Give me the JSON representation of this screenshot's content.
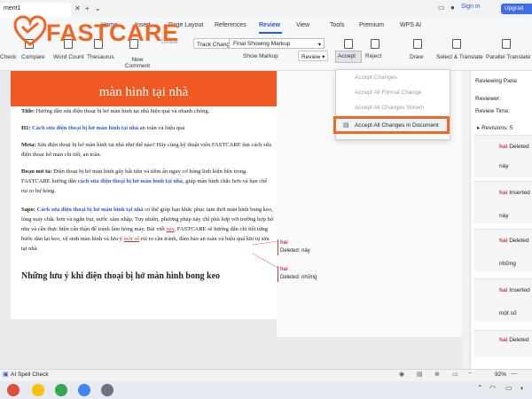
{
  "window": {
    "doc_tab": "ment1",
    "signin": "Sign in",
    "upgrade": "Upgrad"
  },
  "logo": {
    "text": "FASTCARE"
  },
  "menu": [
    "Home",
    "Insert",
    "Page Layout",
    "References",
    "Review",
    "View",
    "Tools",
    "Premium",
    "WPS AI"
  ],
  "ribbon": {
    "check": "Check",
    "compare": "Compare",
    "word_count": "Word Count",
    "thesaurus": "Thesaurus",
    "new_comment": "New Comment",
    "delete": "Delete",
    "track_changes": "Track Changes",
    "markup_value": "Final Showing Markup",
    "show_markup": "Show Markup",
    "review": "Review",
    "accept": "Accept",
    "reject": "Reject",
    "draw": "Draw",
    "select_translate": "Select & Translate",
    "parallel_translate": "Parallel Translate"
  },
  "accept_menu": [
    "Accept Changes",
    "Accept All Format Change",
    "Accept All Changes Shown",
    "Accept All Changes in Document"
  ],
  "document": {
    "banner": "màn hình tại nhà",
    "title_label": "Title:",
    "title_text": "Hướng dẫn sửa điện thoại bị hở màn hình tại nhà hiệu quả và nhanh chóng.",
    "h1_label": "H1:",
    "h1_link": "Cách sửa điện thoại bị hở màn hình tại nhà",
    "h1_rest": " an toàn và hiệu quả",
    "meta_label": "Meta:",
    "meta_text": "Sửa điện thoại bị hở màn hình tại nhà như thế nào? Hãy cùng kỹ thuật viên FASTCARE tìm cách sửa điện thoại hở màn chi tiết, an toàn.",
    "intro_label": "Đoạn mở tả:",
    "intro_text": "Điện thoại bị hở màn hình gây bất tiện và tiềm ẩn nguy cơ hỏng linh kiện bên trong. FASTCARE hướng dẫn",
    "intro_link": "cách sửa điện thoại bị hở màn hình tại nhà",
    "intro_end": ", giúp màn hình chắc hơn và hạn chế rủi ro hư hỏng.",
    "sapo_label": "Sapo:",
    "sapo_link": "Cách sửa điện thoại bị hở màn hình tại nhà",
    "sapo_text": " có thể giúp bạn khắc phục tạm thời màn hình bung keo, lỏng máy chắc hơn và ngăn bụi, nước xâm nhập. Tuy nhiên, phương pháp này chỉ phù hợp với trường hợp hở nhẹ và cần thực hiện cẩn thận để tránh làm hỏng máy. Bài viết",
    "sapo_ins1": "này",
    "sapo_mid": ", FASTCARE sẽ hướng dẫn chi tiết từng bước dán lại keo, vệ sinh màn hình và lưu ý",
    "sapo_ins2": "một số",
    "sapo_end": " rủi ro cần tránh, đảm bảo an toàn và hiệu quả khi tự sửa tại nhà.",
    "heading": "Những lưu ý khi điện thoại bị hở màn hình bong keo"
  },
  "balloons": [
    {
      "who": "hai",
      "text": "Deleted: này"
    },
    {
      "who": "hai",
      "text": "Deleted: những"
    }
  ],
  "reviewing_pane": {
    "title": "Reviewing Pane",
    "reviewer": "Reviewer:",
    "review_time": "Review Time:",
    "revisions": "Revisions: 5",
    "cards": [
      {
        "who": "hai",
        "action": "Deleted",
        "text": "này"
      },
      {
        "who": "hai",
        "action": "Inserted",
        "text": "này"
      },
      {
        "who": "hai",
        "action": "Deleted",
        "text": "những"
      },
      {
        "who": "hai",
        "action": "Inserted",
        "text": "một số"
      },
      {
        "who": "hai",
        "action": "Deleted",
        "text": ""
      }
    ]
  },
  "status": {
    "spell": "AI Spell Check",
    "zoom": "92%"
  }
}
